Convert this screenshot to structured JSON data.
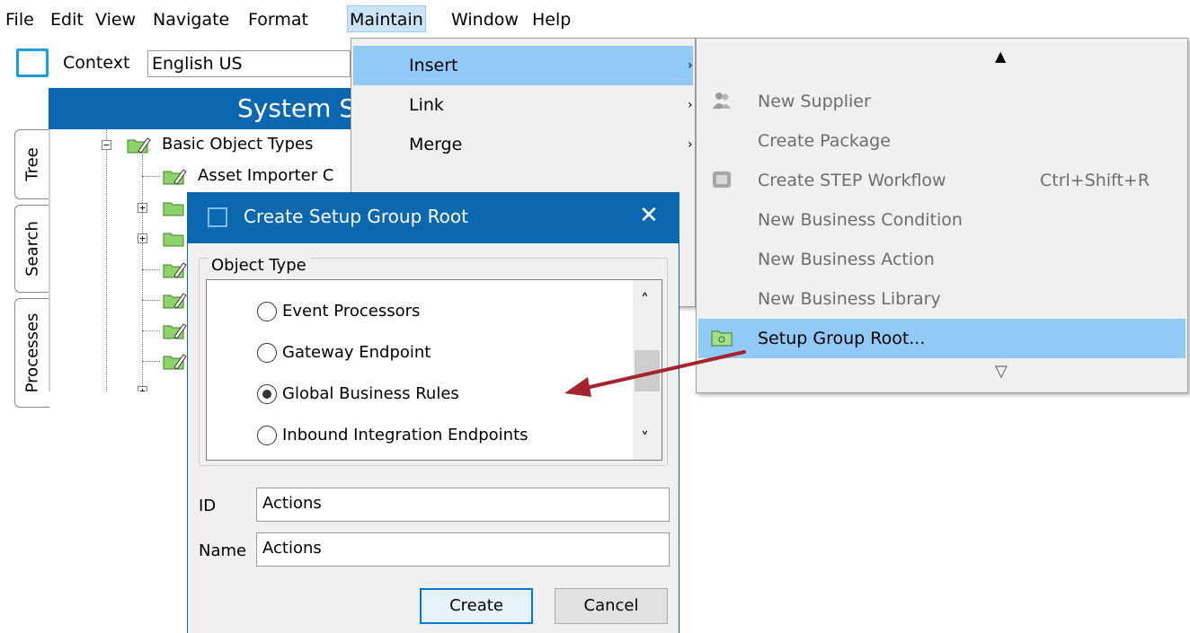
{
  "menubar": {
    "items": [
      {
        "label": "File"
      },
      {
        "label": "Edit"
      },
      {
        "label": "View"
      },
      {
        "label": "Navigate"
      },
      {
        "label": "Format"
      },
      {
        "label": "Maintain"
      },
      {
        "label": "Window"
      },
      {
        "label": "Help"
      }
    ]
  },
  "context": {
    "label": "Context",
    "value": "English US"
  },
  "system_header": {
    "text": "System S"
  },
  "left_tabs": [
    {
      "label": "Tree"
    },
    {
      "label": "Search"
    },
    {
      "label": "Processes"
    }
  ],
  "tree": {
    "root_label": "Basic Object Types",
    "child_label": "Asset Importer C"
  },
  "maintain_menu": {
    "items": [
      {
        "label": "Insert"
      },
      {
        "label": "Link"
      },
      {
        "label": "Merge"
      }
    ]
  },
  "insert_menu": {
    "items": [
      {
        "label": "New Supplier",
        "shortcut": ""
      },
      {
        "label": "Create Package",
        "shortcut": ""
      },
      {
        "label": "Create STEP Workflow",
        "shortcut": "Ctrl+Shift+R"
      },
      {
        "label": "New Business Condition",
        "shortcut": ""
      },
      {
        "label": "New Business Action",
        "shortcut": ""
      },
      {
        "label": "New Business Library",
        "shortcut": ""
      },
      {
        "label": "Setup Group Root...",
        "shortcut": ""
      }
    ],
    "scroll_up_glyph": "▲",
    "scroll_down_glyph": "▽"
  },
  "dialog": {
    "title": "Create Setup Group Root",
    "close_glyph": "✕",
    "object_type_legend": "Object Type",
    "options": [
      {
        "label": "Event Processors",
        "selected": false
      },
      {
        "label": "Gateway Endpoint",
        "selected": false
      },
      {
        "label": "Global Business Rules",
        "selected": true
      },
      {
        "label": "Inbound Integration Endpoints",
        "selected": false
      }
    ],
    "id_label": "ID",
    "id_value": "Actions",
    "name_label": "Name",
    "name_value": "Actions",
    "create_label": "Create",
    "cancel_label": "Cancel"
  },
  "colors": {
    "accent_blue": "#0b67b0",
    "menu_highlight": "#91c9f7",
    "annotation_arrow": "#a4232e"
  }
}
